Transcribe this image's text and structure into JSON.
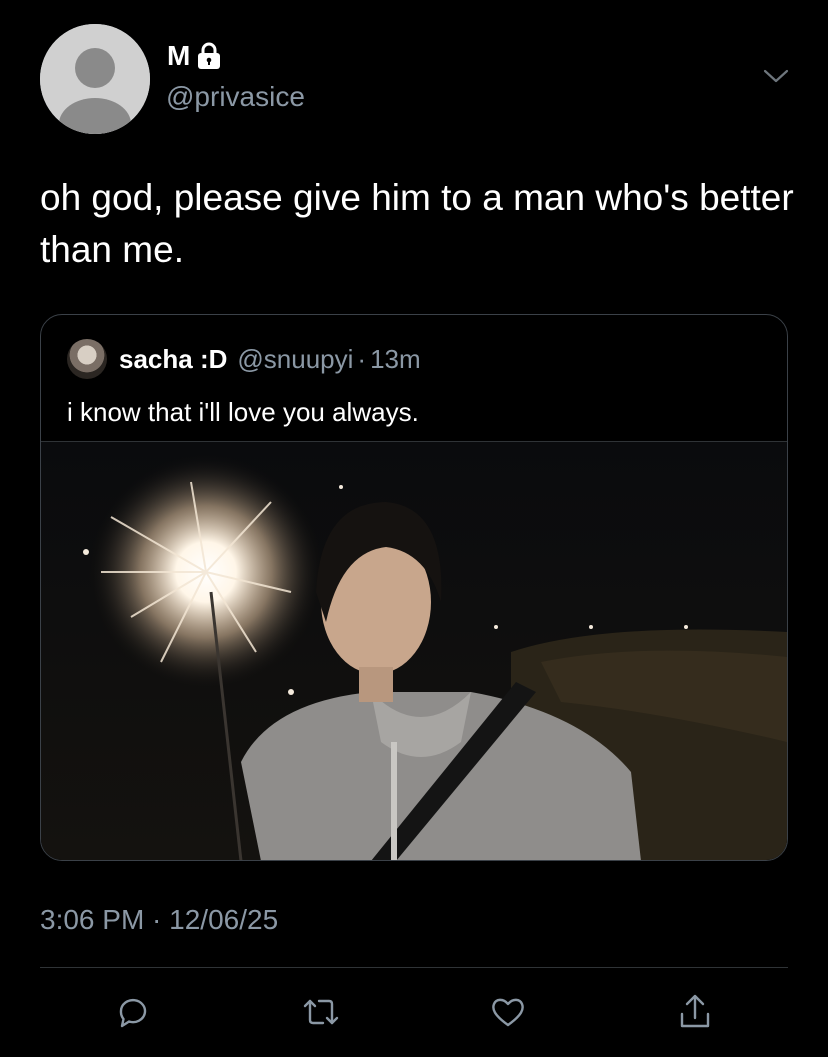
{
  "author": {
    "display_name": "M",
    "handle": "@privasice",
    "protected": true
  },
  "tweet": {
    "text": "oh god, please give him to a man who's better than me.",
    "timestamp": "3:06 PM · 12/06/25"
  },
  "quoted_tweet": {
    "display_name": "sacha :D",
    "handle": "@snuupyi",
    "separator": "·",
    "age": "13m",
    "text": "i know that i'll love you always."
  },
  "icons": {
    "menu": "chevron-down-icon",
    "reply": "reply-icon",
    "retweet": "retweet-icon",
    "like": "heart-icon",
    "share": "share-icon",
    "lock": "lock-icon"
  },
  "colors": {
    "background": "#000000",
    "primary_text": "#ffffff",
    "secondary_text": "#8b98a5",
    "border": "#2f3336"
  }
}
